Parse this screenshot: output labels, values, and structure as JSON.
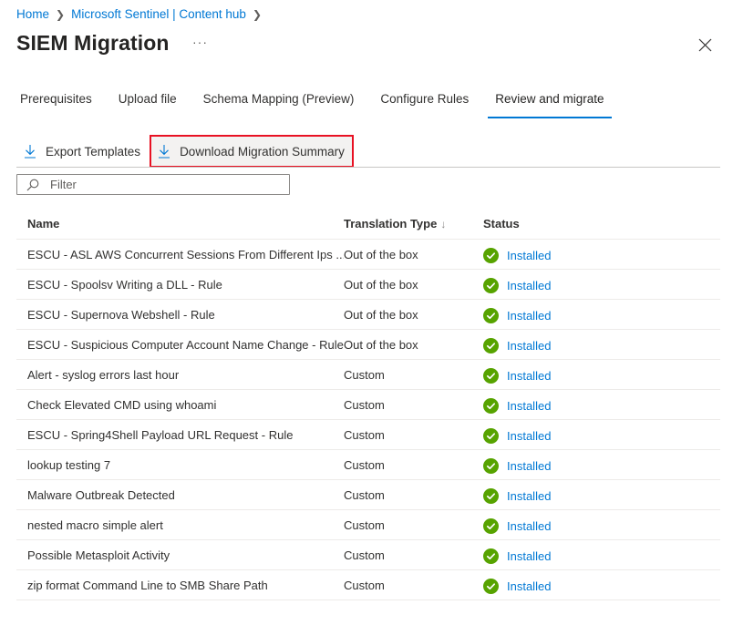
{
  "breadcrumb": [
    {
      "label": "Home"
    },
    {
      "label": "Microsoft Sentinel | Content hub"
    }
  ],
  "header": {
    "title": "SIEM Migration",
    "more_label": "···",
    "close_icon": "close-icon"
  },
  "tabs": [
    {
      "label": "Prerequisites",
      "active": false
    },
    {
      "label": "Upload file",
      "active": false
    },
    {
      "label": "Schema Mapping (Preview)",
      "active": false
    },
    {
      "label": "Configure Rules",
      "active": false
    },
    {
      "label": "Review and migrate",
      "active": true
    }
  ],
  "toolbar": {
    "export_label": "Export Templates",
    "download_label": "Download Migration Summary",
    "icon": "download-icon",
    "highlight_color": "#e81123"
  },
  "filter": {
    "placeholder": "Filter",
    "value": ""
  },
  "table": {
    "columns": [
      {
        "label": "Name"
      },
      {
        "label": "Translation Type",
        "sort": "descending",
        "sort_glyph": "↓"
      },
      {
        "label": "Status"
      }
    ],
    "rows": [
      {
        "name": "ESCU - ASL AWS Concurrent Sessions From Different Ips ...",
        "type": "Out of the box",
        "status": "Installed"
      },
      {
        "name": "ESCU - Spoolsv Writing a DLL - Rule",
        "type": "Out of the box",
        "status": "Installed"
      },
      {
        "name": "ESCU - Supernova Webshell - Rule",
        "type": "Out of the box",
        "status": "Installed"
      },
      {
        "name": "ESCU - Suspicious Computer Account Name Change - Rule",
        "type": "Out of the box",
        "status": "Installed"
      },
      {
        "name": "Alert - syslog errors last hour",
        "type": "Custom",
        "status": "Installed"
      },
      {
        "name": "Check Elevated CMD using whoami",
        "type": "Custom",
        "status": "Installed"
      },
      {
        "name": "ESCU - Spring4Shell Payload URL Request - Rule",
        "type": "Custom",
        "status": "Installed"
      },
      {
        "name": "lookup testing 7",
        "type": "Custom",
        "status": "Installed"
      },
      {
        "name": "Malware Outbreak Detected",
        "type": "Custom",
        "status": "Installed"
      },
      {
        "name": "nested macro simple alert",
        "type": "Custom",
        "status": "Installed"
      },
      {
        "name": "Possible Metasploit Activity",
        "type": "Custom",
        "status": "Installed"
      },
      {
        "name": "zip format Command Line to SMB Share Path",
        "type": "Custom",
        "status": "Installed"
      }
    ]
  },
  "colors": {
    "accent": "#0078d4",
    "success": "#57a300",
    "highlight": "#e81123"
  }
}
